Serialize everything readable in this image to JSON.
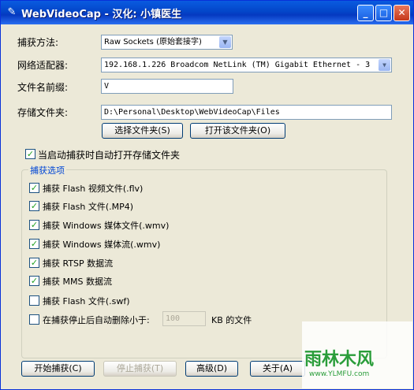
{
  "window": {
    "title": "WebVideoCap - 汉化: 小镇医生"
  },
  "form": {
    "method_label": "捕获方法:",
    "method_value": "Raw Sockets (原始套接字)",
    "adapter_label": "网络适配器:",
    "adapter_value": "192.168.1.226   Broadcom NetLink (TM) Gigabit Ethernet - 3",
    "prefix_label": "文件名前缀:",
    "prefix_value": "V",
    "folder_label": "存储文件夹:",
    "folder_value": "D:\\Personal\\Desktop\\WebVideoCap\\Files",
    "choose_folder_button": "选择文件夹(S)",
    "open_folder_button": "打开该文件夹(O)",
    "auto_open_label": "当启动捕获时自动打开存储文件夹"
  },
  "capture": {
    "group_title": "捕获选项",
    "options": [
      {
        "label": "捕获 Flash 视频文件(.flv)",
        "checked": true
      },
      {
        "label": "捕获 Flash 文件(.MP4)",
        "checked": true
      },
      {
        "label": "捕获 Windows 媒体文件(.wmv)",
        "checked": true
      },
      {
        "label": "捕获 Windows 媒体流(.wmv)",
        "checked": true
      },
      {
        "label": "捕获 RTSP 数据流",
        "checked": true
      },
      {
        "label": "捕获 MMS 数据流",
        "checked": true
      },
      {
        "label": "捕获 Flash 文件(.swf)",
        "checked": false
      }
    ],
    "delete_small_label": "在捕获停止后自动删除小于:",
    "delete_small_value": "100",
    "delete_small_unit": "KB 的文件"
  },
  "buttons": {
    "start": "开始捕获(C)",
    "stop": "停止捕获(T)",
    "advanced": "高级(D)",
    "about": "关于(A)"
  },
  "watermark": {
    "text": "雨林木风",
    "url": "www.YLMFU.com"
  },
  "colors": {
    "title_bar": "#0346c9",
    "window_bg": "#ece9d8",
    "check_mark": "#21a121",
    "group_title": "#0046d5"
  }
}
